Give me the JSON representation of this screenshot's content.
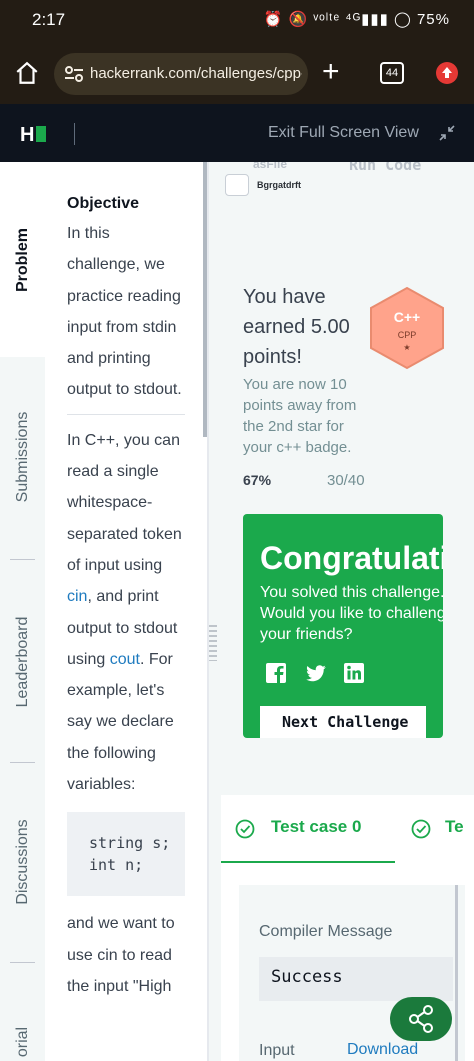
{
  "status_bar": {
    "time": "2:17",
    "battery": "75%",
    "icons_text": "⏰ 🔕 ᵛᵒˡᵗᵉ ⁴ᴳ▮▮▮ ◯"
  },
  "browser": {
    "url": "hackerrank.com/challenges/cpp-inp",
    "tab_count": "44",
    "plus_label": "+",
    "home_icon": "home-icon",
    "tune_icon": "tune-icon"
  },
  "header": {
    "logo_letter": "H",
    "exit_fullscreen": "Exit Full Screen View",
    "brand_color": "#1ba94c"
  },
  "vertical_tabs": [
    {
      "label": "Problem",
      "active": true
    },
    {
      "label": "Submissions",
      "active": false
    },
    {
      "label": "Leaderboard",
      "active": false
    },
    {
      "label": "Discussions",
      "active": false
    },
    {
      "label": "orial",
      "active": false
    }
  ],
  "problem": {
    "objective_title": "Objective",
    "para1": "In this challenge, we practice reading input from stdin and printing output to stdout.",
    "para2_a": "In C++, you can read a single whitespace-separated token of input using ",
    "para2_cin": "cin",
    "para2_b": ", and print output to stdout using ",
    "para2_cout": "cout",
    "para2_c": ". For example, let's say we declare the following variables:",
    "code": "string s;\nint n;",
    "para3": "and we want to use cin to read the input \"High"
  },
  "right_pane": {
    "faded_upload": "asFile",
    "faded_run": "Run Code",
    "garbled": "Bgrgatdrft",
    "earned": "You have earned 5.00 points!",
    "subtext": "You are now 10 points away from the 2nd star for your c++ badge.",
    "percent": "67%",
    "ratio": "30/40",
    "badge": {
      "title": "C++",
      "subtitle": "CPP",
      "star": "★",
      "color": "#ffa38b"
    },
    "congrats": {
      "title": "Congratulations",
      "line1": "You solved this challenge.",
      "line2": "Would you like to challenge",
      "line3": "your friends?",
      "next_button": "Next Challenge",
      "social": [
        "facebook-icon",
        "twitter-icon",
        "linkedin-icon"
      ]
    },
    "testcase": {
      "tab0": "Test case 0",
      "tab1": "Te",
      "compiler_label": "Compiler Message",
      "compiler_value": "Success",
      "input_label": "Input (stdin)",
      "download": "Download"
    }
  }
}
